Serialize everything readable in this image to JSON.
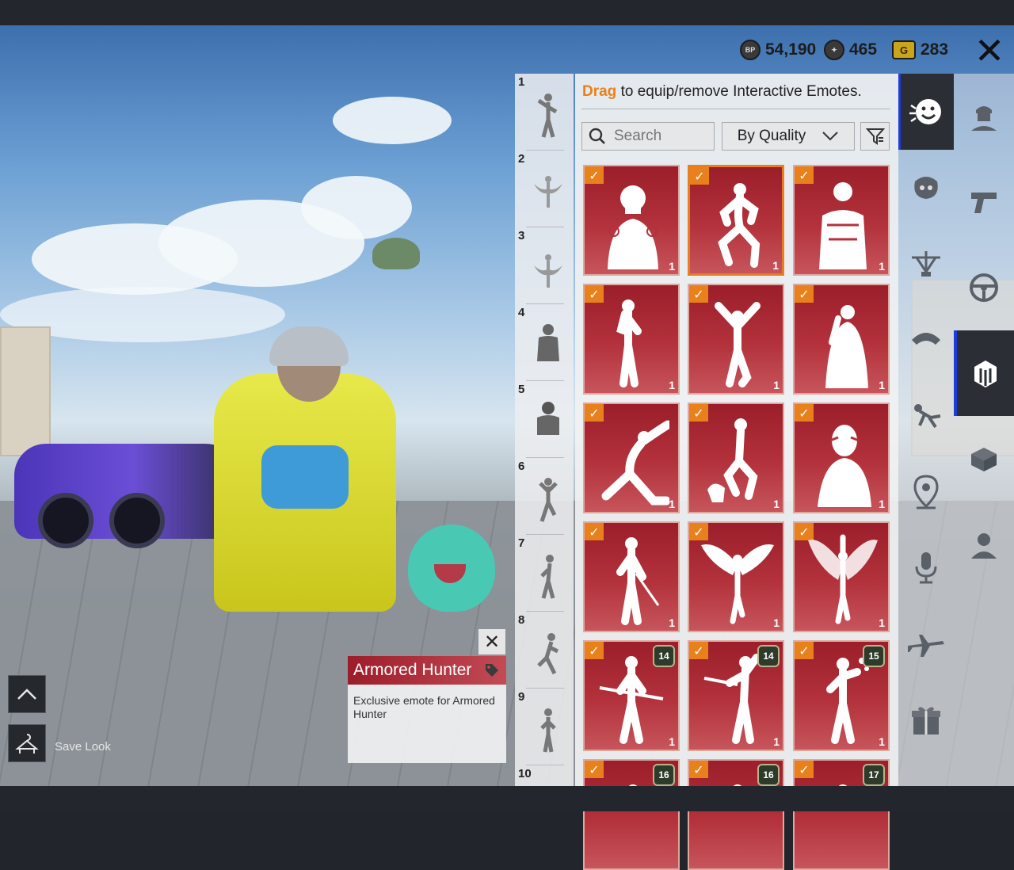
{
  "currencies": [
    {
      "icon": "bp-coin-icon",
      "icon_text": "BP",
      "value": "54,190"
    },
    {
      "icon": "silver-fragment-icon",
      "icon_text": "",
      "value": "465"
    },
    {
      "icon": "gold-coupon-icon",
      "icon_text": "G",
      "value": "283"
    }
  ],
  "close_icon": "close-icon",
  "hint": {
    "accent": "Drag",
    "rest": " to equip/remove Interactive Emotes."
  },
  "search": {
    "placeholder": "Search"
  },
  "sort": {
    "label": "By Quality"
  },
  "slots": [
    "1",
    "2",
    "3",
    "4",
    "5",
    "6",
    "7",
    "8",
    "9",
    "10"
  ],
  "cards": [
    {
      "count": "1",
      "level": "",
      "fig": "helmet-pose"
    },
    {
      "count": "1",
      "level": "",
      "fig": "crouch-dance",
      "selected": true
    },
    {
      "count": "1",
      "level": "",
      "fig": "armored-soldier"
    },
    {
      "count": "1",
      "level": "",
      "fig": "hand-on-chin"
    },
    {
      "count": "1",
      "level": "",
      "fig": "arms-raised"
    },
    {
      "count": "1",
      "level": "",
      "fig": "shy-pose"
    },
    {
      "count": "1",
      "level": "",
      "fig": "side-stretch"
    },
    {
      "count": "1",
      "level": "",
      "fig": "pet-cat"
    },
    {
      "count": "1",
      "level": "",
      "fig": "masked-face"
    },
    {
      "count": "1",
      "level": "",
      "fig": "sword-pose"
    },
    {
      "count": "1",
      "level": "",
      "fig": "angel-wings"
    },
    {
      "count": "1",
      "level": "",
      "fig": "winged-raise"
    },
    {
      "count": "1",
      "level": "14",
      "fig": "rifle-hold"
    },
    {
      "count": "1",
      "level": "14",
      "fig": "rifle-salute"
    },
    {
      "count": "1",
      "level": "15",
      "fig": "juggle"
    },
    {
      "count": "",
      "level": "16",
      "fig": "partial"
    },
    {
      "count": "",
      "level": "16",
      "fig": "partial"
    },
    {
      "count": "",
      "level": "17",
      "fig": "partial"
    }
  ],
  "left_tabs": [
    "emote-icon",
    "pet-icon",
    "parachute-icon",
    "glider-icon",
    "landing-icon",
    "map-pin-icon",
    "microphone-icon",
    "airplane-icon",
    "gift-box-icon"
  ],
  "right_tabs": [
    "character-icon",
    "pistol-icon",
    "steering-wheel-icon",
    "outfit-hanger-icon",
    "box-icon",
    "hunter-avatar-icon"
  ],
  "tooltip": {
    "title": "Armored Hunter",
    "description": "Exclusive emote for Armored Hunter"
  },
  "bottom_left": {
    "save_label": "Save Look"
  },
  "colors": {
    "accent": "#e8811b",
    "card_red": "#b3323c",
    "active_tab": "#2b2f35",
    "selection_blue": "#1f3bd8"
  }
}
